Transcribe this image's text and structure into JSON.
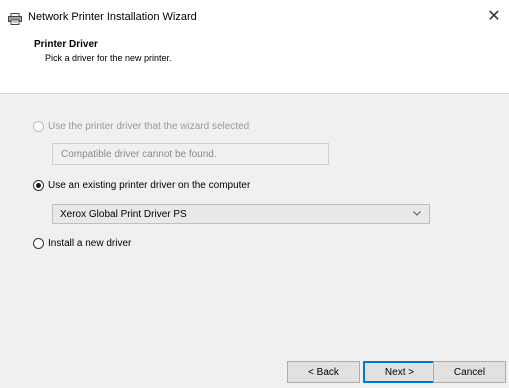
{
  "window": {
    "title": "Network Printer Installation Wizard",
    "close_glyph": "✕"
  },
  "header": {
    "title": "Printer Driver",
    "subtitle": "Pick a driver for the new printer."
  },
  "options": {
    "wizard_selected": {
      "label": "Use the printer driver that the wizard selected",
      "checked": false,
      "enabled": false,
      "field_value": "Compatible driver cannot be found."
    },
    "existing": {
      "label": "Use an existing printer driver on the computer",
      "checked": true,
      "enabled": true,
      "selected_driver": "Xerox Global Print Driver PS"
    },
    "install_new": {
      "label": "Install a new driver",
      "checked": false,
      "enabled": true
    }
  },
  "buttons": {
    "back": "< Back",
    "next": "Next >",
    "cancel": "Cancel"
  },
  "icons": {
    "app": "printer-icon",
    "close": "close-icon",
    "dropdown": "chevron-down-icon"
  },
  "colors": {
    "accent": "#0078d7",
    "panel": "#f0f0f0",
    "disabled_text": "#9a9a9a"
  }
}
